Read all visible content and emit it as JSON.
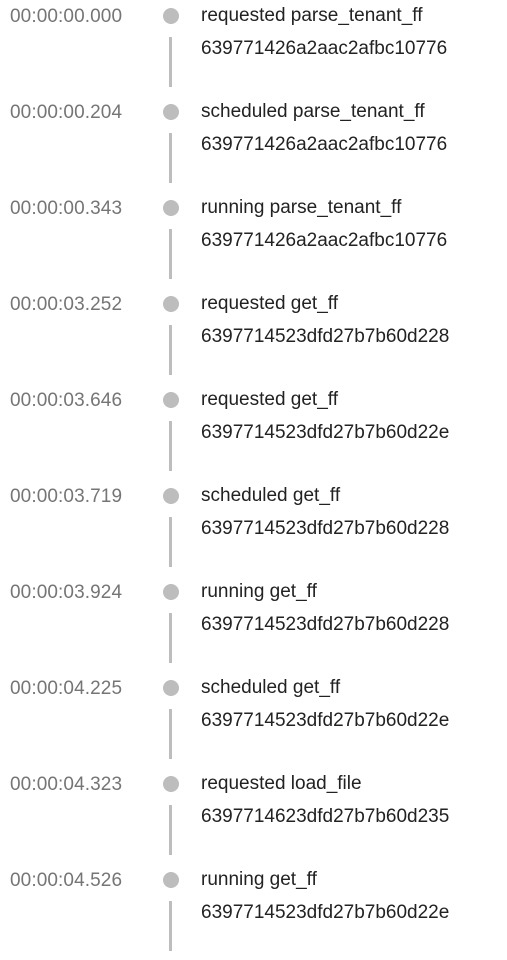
{
  "events": [
    {
      "time": "00:00:00.000",
      "action": "requested parse_tenant_ff",
      "id": "639771426a2aac2afbc10776"
    },
    {
      "time": "00:00:00.204",
      "action": "scheduled parse_tenant_ff",
      "id": "639771426a2aac2afbc10776"
    },
    {
      "time": "00:00:00.343",
      "action": "running parse_tenant_ff",
      "id": "639771426a2aac2afbc10776"
    },
    {
      "time": "00:00:03.252",
      "action": "requested get_ff",
      "id": "6397714523dfd27b7b60d228"
    },
    {
      "time": "00:00:03.646",
      "action": "requested get_ff",
      "id": "6397714523dfd27b7b60d22e"
    },
    {
      "time": "00:00:03.719",
      "action": "scheduled get_ff",
      "id": "6397714523dfd27b7b60d228"
    },
    {
      "time": "00:00:03.924",
      "action": "running get_ff",
      "id": "6397714523dfd27b7b60d228"
    },
    {
      "time": "00:00:04.225",
      "action": "scheduled get_ff",
      "id": "6397714523dfd27b7b60d22e"
    },
    {
      "time": "00:00:04.323",
      "action": "requested load_file",
      "id": "6397714623dfd27b7b60d235"
    },
    {
      "time": "00:00:04.526",
      "action": "running get_ff",
      "id": "6397714523dfd27b7b60d22e"
    }
  ]
}
